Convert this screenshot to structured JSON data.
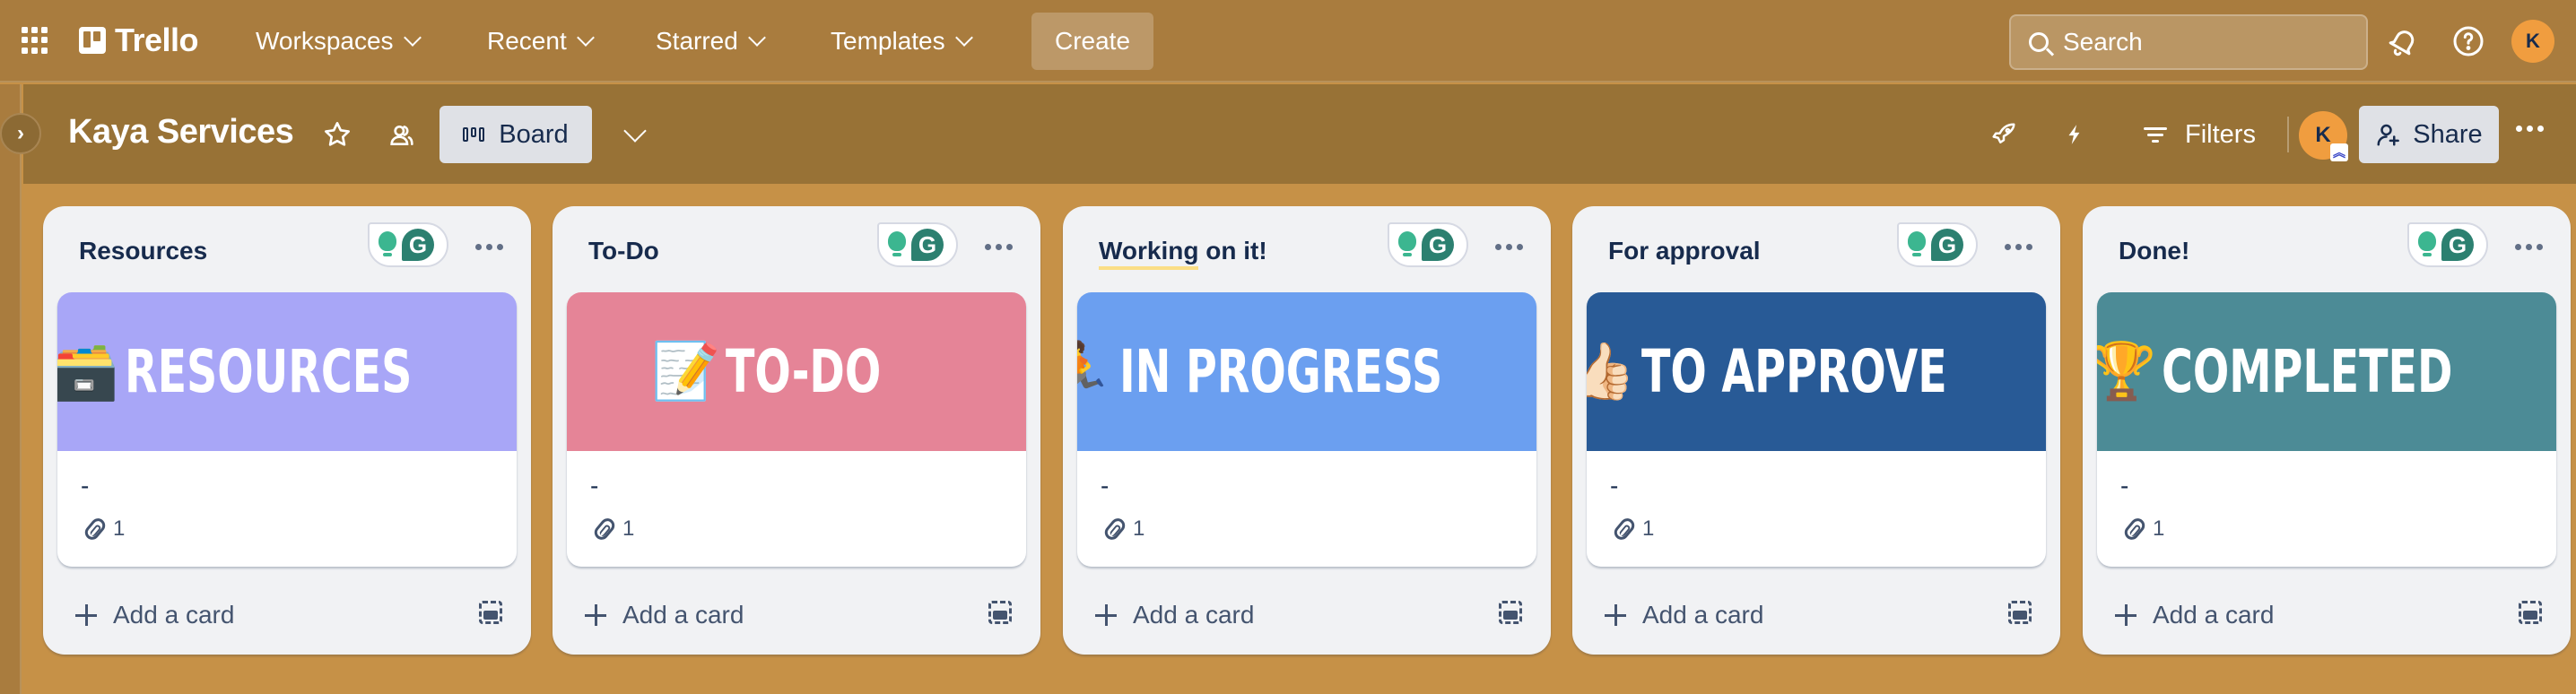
{
  "app": {
    "name": "Trello",
    "nav": [
      {
        "label": "Workspaces"
      },
      {
        "label": "Recent"
      },
      {
        "label": "Starred"
      },
      {
        "label": "Templates"
      }
    ],
    "create_label": "Create",
    "search": {
      "placeholder": "Search",
      "value": ""
    },
    "user_initial": "K",
    "icons": {
      "apps": "grid-icon",
      "notifications": "bell-icon",
      "help": "help-circle-icon"
    }
  },
  "board": {
    "title": "Kaya Services",
    "view_label": "Board",
    "filters_label": "Filters",
    "share_label": "Share",
    "member_initial": "K",
    "admin_badge": "»",
    "colors": {
      "header": "#A97C3E",
      "board_bar": "#987236",
      "background": "#C69147",
      "avatar": "#F09D3F"
    }
  },
  "lists": [
    {
      "title": "Resources",
      "cover": {
        "emoji": "🗃️",
        "text": "RESOURCES",
        "color": "#A8A6F7"
      },
      "cards": [
        {
          "title": "-",
          "attachments": "1"
        }
      ],
      "add_card_label": "Add a card"
    },
    {
      "title": "To-Do",
      "cover": {
        "emoji": "📝",
        "text": "TO-DO",
        "color": "#E58497"
      },
      "cards": [
        {
          "title": "-",
          "attachments": "1"
        }
      ],
      "add_card_label": "Add a card"
    },
    {
      "title_parts": [
        "Working",
        " on it!"
      ],
      "title": "Working on it!",
      "cover": {
        "emoji": "🏃",
        "text": "IN PROGRESS",
        "color": "#6B9FF0"
      },
      "cards": [
        {
          "title": "-",
          "attachments": "1"
        }
      ],
      "add_card_label": "Add a card"
    },
    {
      "title": "For approval",
      "cover": {
        "emoji": "👍🏻",
        "text": "TO APPROVE",
        "color": "#285A96"
      },
      "cards": [
        {
          "title": "-",
          "attachments": "1"
        }
      ],
      "add_card_label": "Add a card"
    },
    {
      "title": "Done!",
      "cover": {
        "emoji": "🏆",
        "text": "COMPLETED",
        "color": "#4C8B96"
      },
      "cards": [
        {
          "title": "-",
          "attachments": "1"
        }
      ],
      "add_card_label": "Add a card"
    }
  ]
}
